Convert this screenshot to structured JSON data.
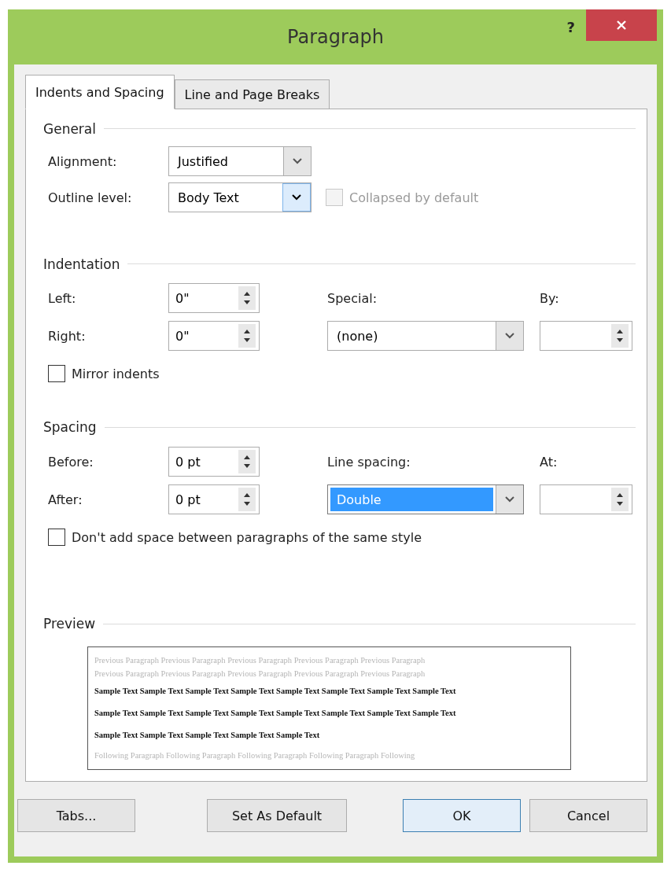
{
  "window": {
    "title": "Paragraph",
    "help": "?"
  },
  "tabs": [
    {
      "label": "Indents and Spacing",
      "selected": true
    },
    {
      "label": "Line and Page Breaks",
      "selected": false
    }
  ],
  "general": {
    "heading": "General",
    "alignment": {
      "label": "Alignment:",
      "value": "Justified",
      "focused": false
    },
    "outline_level": {
      "label": "Outline level:",
      "value": "Body Text",
      "focused": true
    },
    "collapsed": {
      "label": "Collapsed by default",
      "checked": false,
      "disabled": true
    }
  },
  "indentation": {
    "heading": "Indentation",
    "left": {
      "label": "Left:",
      "value": "0\""
    },
    "right": {
      "label": "Right:",
      "value": "0\""
    },
    "special": {
      "label": "Special:",
      "value": "(none)",
      "highlighted": false
    },
    "by": {
      "label": "By:"
    },
    "mirror": {
      "label": "Mirror indents",
      "checked": false,
      "disabled": false
    }
  },
  "spacing": {
    "heading": "Spacing",
    "before": {
      "label": "Before:",
      "value": "0 pt"
    },
    "after": {
      "label": "After:",
      "value": "0 pt"
    },
    "line_spacing": {
      "label": "Line spacing:",
      "value": "Double",
      "highlighted": true
    },
    "at": {
      "label": "At:"
    },
    "dont_add": {
      "label": "Don't add space between paragraphs of the same style",
      "checked": false,
      "disabled": false
    }
  },
  "preview": {
    "heading": "Preview",
    "lines": [
      {
        "kind": "previous",
        "text": "Previous Paragraph Previous Paragraph Previous Paragraph Previous Paragraph Previous Paragraph"
      },
      {
        "kind": "previous",
        "text": "Previous Paragraph Previous Paragraph Previous Paragraph Previous Paragraph Previous Paragraph"
      },
      {
        "kind": "sample",
        "text": "Sample Text Sample Text Sample Text Sample Text Sample Text Sample Text Sample Text Sample Text"
      },
      {
        "kind": "sample",
        "text": "Sample Text Sample Text Sample Text Sample Text Sample Text Sample Text Sample Text Sample Text"
      },
      {
        "kind": "sample",
        "text": "Sample Text Sample Text Sample Text Sample Text Sample Text"
      },
      {
        "kind": "following",
        "text": "Following Paragraph Following Paragraph Following Paragraph Following Paragraph Following"
      }
    ]
  },
  "buttons": [
    {
      "label": "Tabs...",
      "default": false
    },
    {
      "label": "Set As Default",
      "default": false
    },
    {
      "label": "OK",
      "default": true
    },
    {
      "label": "Cancel",
      "default": false
    }
  ]
}
